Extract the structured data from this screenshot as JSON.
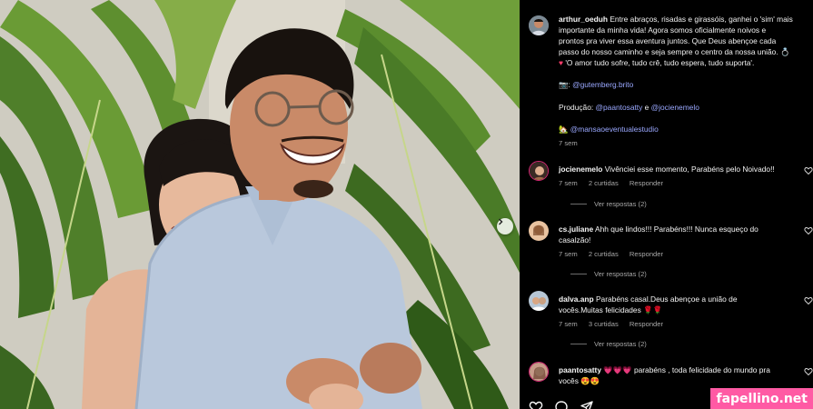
{
  "post": {
    "username": "arthur_oeduh",
    "caption_lines": [
      "Entre abraços, risadas e girassóis, ganhei o 'sim' mais",
      "importante da minha vida! Agora somos oficialmente noivos e",
      "prontos pra viver essa aventura juntos. Que Deus abençoe cada",
      "passo do nosso caminho e seja sempre o centro da nossa união. 💍",
      "'O amor tudo sofre, tudo crê, tudo espera, tudo suporta'."
    ],
    "photo_credit_mention": "@gutemberg.brito",
    "production_label": "Produção:",
    "production_mention_1": "@paantosatty",
    "production_and": "e",
    "production_mention_2": "@jocienemelo",
    "venue_mention": "@mansaoeventualestudio",
    "time": "7 sem"
  },
  "comments": [
    {
      "username": "jocienemelo",
      "text": "Vivênciei esse momento, Parabéns pelo Noivado!!",
      "time": "7 sem",
      "likes": "2 curtidas",
      "reply": "Responder",
      "view_replies": "Ver respostas (2)"
    },
    {
      "username": "cs.juliane",
      "text": "Ahh que lindos!!! Parabéns!!! Nunca esqueço do",
      "text2": "casalzão!",
      "time": "7 sem",
      "likes": "2 curtidas",
      "reply": "Responder",
      "view_replies": "Ver respostas (2)"
    },
    {
      "username": "dalva.anp",
      "text": "Parabéns casal.Deus abençoe a união de",
      "text2": "vocês.Muitas felicidades 🌹🌹",
      "time": "7 sem",
      "likes": "3 curtidas",
      "reply": "Responder",
      "view_replies": "Ver respostas (2)"
    },
    {
      "username": "paantosatty",
      "text": "💗💗💗 parabéns , toda felicidade do mundo pra",
      "text2": "vocês 😍😍"
    }
  ],
  "watermark": "fapellino.net",
  "colors": {
    "background": "#000000",
    "mention": "#9aa8ff",
    "muted": "#a8a8a8",
    "watermark_bg": "#ff5aa4"
  },
  "icons": [
    "chevron-right-icon",
    "heart-outline-icon",
    "comment-icon",
    "share-icon"
  ]
}
